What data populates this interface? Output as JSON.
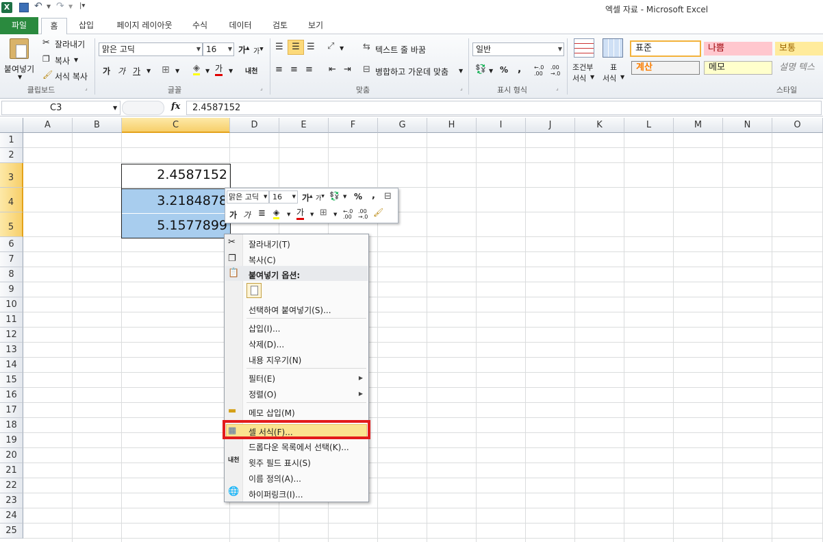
{
  "window": {
    "title": "엑셀 자료 - Microsoft Excel"
  },
  "tabs": {
    "file": "파일",
    "home": "홈",
    "insert": "삽입",
    "page_layout": "페이지 레이아웃",
    "formulas": "수식",
    "data": "데이터",
    "review": "검토",
    "view": "보기"
  },
  "ribbon": {
    "clipboard": {
      "paste": "붙여넣기",
      "cut": "잘라내기",
      "copy": "복사",
      "format_painter": "서식 복사",
      "label": "클립보드"
    },
    "font": {
      "name": "맑은 고딕",
      "size": "16",
      "grow": "가",
      "shrink": "가",
      "bold": "가",
      "italic": "가",
      "underline": "가",
      "color_a": "가",
      "phonetic": "내천",
      "label": "글꼴"
    },
    "alignment": {
      "wrap": "텍스트 줄 바꿈",
      "merge": "병합하고 가운데 맞춤",
      "label": "맞춤"
    },
    "number": {
      "format": "일반",
      "percent": "%",
      "comma": ",",
      "inc": "←.0 .00",
      "dec": ".00 →.0",
      "label": "표시 형식"
    },
    "styles": {
      "cond": "조건부",
      "cond2": "서식",
      "table": "표",
      "table2": "서식",
      "normal": "표준",
      "bad": "나쁨",
      "neutral": "보통",
      "calc": "계산",
      "memo": "메모",
      "explain": "설명 텍스",
      "label": "스타일"
    }
  },
  "formula_bar": {
    "name_box": "C3",
    "fx": "fx",
    "value": "2.4587152"
  },
  "columns": [
    "A",
    "B",
    "C",
    "D",
    "E",
    "F",
    "G",
    "H",
    "I",
    "J",
    "K",
    "L",
    "M",
    "N",
    "O"
  ],
  "rows": [
    "1",
    "2",
    "3",
    "4",
    "5",
    "6",
    "7",
    "8",
    "9",
    "10",
    "11",
    "12",
    "13",
    "14",
    "15",
    "16",
    "17",
    "18",
    "19",
    "20",
    "21",
    "22",
    "23",
    "24",
    "25"
  ],
  "cells": {
    "c3": "2.4587152",
    "c4": "3.2184878",
    "c5": "5.1577899"
  },
  "mini_toolbar": {
    "font": "맑은 고딕",
    "size": "16",
    "percent": "%",
    "comma": ","
  },
  "context_menu": {
    "cut": "잘라내기(T)",
    "copy": "복사(C)",
    "paste_options": "붙여넣기 옵션:",
    "paste_special": "선택하여 붙여넣기(S)...",
    "insert": "삽입(I)...",
    "delete": "삭제(D)...",
    "clear": "내용 지우기(N)",
    "filter": "필터(E)",
    "sort": "정렬(O)",
    "insert_comment": "메모 삽입(M)",
    "format_cells": "셀 서식(F)...",
    "pick_list": "드롭다운 목록에서 선택(K)...",
    "phonetic": "윗주 필드 표시(S)",
    "define_name": "이름 정의(A)...",
    "hyperlink": "하이퍼링크(I)..."
  },
  "colors": {
    "highlight_box": "#e31b1b",
    "selection": "#a8cdee",
    "menu_hover": "#fbe38f"
  }
}
